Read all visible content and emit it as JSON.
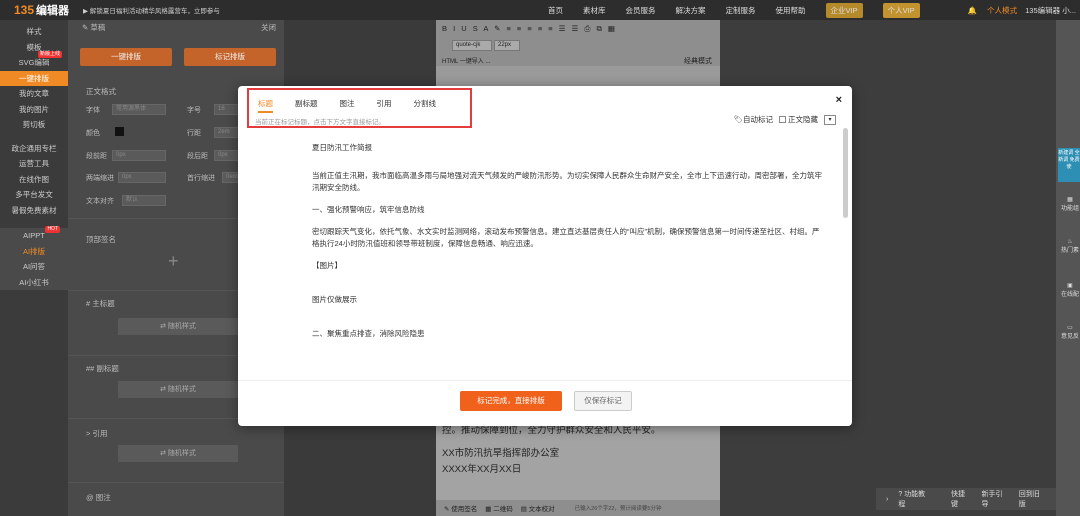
{
  "topbar": {
    "logo_num": "135",
    "logo_text": "编辑器",
    "promo": "▶ 解锁夏日福利活动精华风格露营车，立即参与",
    "nav": [
      "首页",
      "素材库",
      "会员服务",
      "解决方案",
      "定制服务",
      "使用帮助"
    ],
    "vip_enterprise": "企业VIP",
    "vip_personal": "个人VIP",
    "personal_mode": "个人模式",
    "user": "135编辑器 小..."
  },
  "leftnav": {
    "items": [
      "样式",
      "模板",
      "SVG编辑",
      "一键排版",
      "我的文章",
      "我的图片",
      "剪切板",
      "",
      "政企通用专栏",
      "运营工具",
      "在线作图",
      "多平台发文",
      "暑假免费素材"
    ],
    "new_tag": "新版上线",
    "ai_items": [
      "AIPPT",
      "AI排版",
      "AI问答",
      "AI小红书"
    ],
    "hot": "HOT"
  },
  "panel": {
    "draft": "草稿",
    "close": "关闭",
    "btn_one": "一键排版",
    "btn_mark": "标记排版",
    "text_style": "正文格式",
    "font_label": "字体",
    "font_value": "常用源黑体",
    "size_label": "字号",
    "size_value": "16",
    "color_label": "颜色",
    "lh_label": "行距",
    "lh_value": "2em",
    "para_before": "段前距",
    "pb_value": "0px",
    "para_after": "段后距",
    "pa_value": "0px",
    "indent": "两端缩进",
    "indent_value": "0px",
    "first_line": "首行缩进",
    "fl_value": "0em",
    "align": "文本对齐",
    "align_value": "默认",
    "top_sign": "顶部签名",
    "h1": "# 主标题",
    "rand": "随机样式",
    "h2": "## 副标题",
    "quote": "> 引用",
    "caption": "@ 图注"
  },
  "toolbar": {
    "font": "quote-cjk",
    "size": "22px",
    "row2": "HTML 一键导入 ...",
    "mode": "经典模式"
  },
  "editor": {
    "line1": "控。推动保障到位，全力守护群众安全和人民平安。",
    "line2": "XX市防汛抗旱指挥部办公室",
    "line3": "XXXX年XX月XX日",
    "status": "已输入26个字22，预计阅读要5分钟",
    "b1": "使用签名",
    "b2": "二维码",
    "b3": "文本校对"
  },
  "modal": {
    "tabs": [
      "标题",
      "副标题",
      "图注",
      "引用",
      "分割线"
    ],
    "hint": "当前正在标记标题，点击下方文字直接标记。",
    "auto": "自动标记",
    "hide": "正文隐藏",
    "close": "×",
    "paras": [
      "夏日防汛工作简报",
      "当前正值主汛期，我市面临高温多雨与局地强对流天气频发的严峻防汛形势。为切实保障人民群众生命财产安全，全市上下迅速行动，周密部署，全力筑牢汛期安全防线。",
      "一、强化预警响应，筑牢信息防线",
      "密切跟踪天气变化，依托气象、水文实时监测网络，滚动发布预警信息。建立直达基层责任人的“叫应”机制，确保预警信息第一时间传递至社区、村组。严格执行24小时防汛值班和领导带班制度，保障信息畅通、响应迅速。",
      "【图片】",
      "图片仅做展示",
      "二、聚焦重点排查，消除风险隐患"
    ],
    "btn_done": "标记完成，直接排版",
    "btn_save": "仅保存标记"
  },
  "rightside": {
    "items": [
      "功能组",
      "热门素",
      "在线配",
      "意见反"
    ],
    "blue": "新建调 全新调 免费使"
  },
  "bottom": {
    "items": [
      "功能教程",
      "快捷键",
      "新手引导",
      "回到旧版"
    ]
  }
}
